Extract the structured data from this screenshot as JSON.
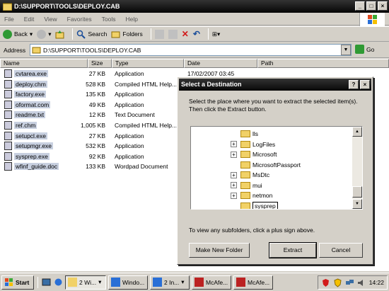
{
  "window": {
    "title": "D:\\SUPPORT\\TOOLS\\DEPLOY.CAB",
    "controls": [
      "_",
      "□",
      "×"
    ]
  },
  "menu": [
    "File",
    "Edit",
    "View",
    "Favorites",
    "Tools",
    "Help"
  ],
  "toolbar": {
    "back": "Back",
    "search": "Search",
    "folders": "Folders",
    "view": "⊞▾"
  },
  "address": {
    "label": "Address",
    "value": "D:\\SUPPORT\\TOOLS\\DEPLOY.CAB",
    "go": "Go"
  },
  "columns": [
    "Name",
    "Size",
    "Type",
    "Date",
    "Path"
  ],
  "files": [
    {
      "name": "cvtarea.exe",
      "size": "27 KB",
      "type": "Application",
      "date": "17/02/2007 03:45"
    },
    {
      "name": "deploy.chm",
      "size": "528 KB",
      "type": "Compiled HTML Help...",
      "date": ""
    },
    {
      "name": "factory.exe",
      "size": "135 KB",
      "type": "Application",
      "date": ""
    },
    {
      "name": "oformat.com",
      "size": "49 KB",
      "type": "Application",
      "date": ""
    },
    {
      "name": "readme.txt",
      "size": "12 KB",
      "type": "Text Document",
      "date": ""
    },
    {
      "name": "ref.chm",
      "size": "1,005 KB",
      "type": "Compiled HTML Help...",
      "date": ""
    },
    {
      "name": "setupcl.exe",
      "size": "27 KB",
      "type": "Application",
      "date": ""
    },
    {
      "name": "setupmgr.exe",
      "size": "532 KB",
      "type": "Application",
      "date": ""
    },
    {
      "name": "sysprep.exe",
      "size": "92 KB",
      "type": "Application",
      "date": ""
    },
    {
      "name": "wfinf_guide.doc",
      "size": "133 KB",
      "type": "Wordpad Document",
      "date": ""
    }
  ],
  "dialog": {
    "title": "Select a Destination",
    "help": "?",
    "close": "×",
    "message": "Select the place where you want to extract the selected item(s).  Then click the Extract button.",
    "tree": [
      {
        "label": "lls",
        "expandable": false
      },
      {
        "label": "LogFiles",
        "expandable": true
      },
      {
        "label": "Microsoft",
        "expandable": true
      },
      {
        "label": "MicrosoftPassport",
        "expandable": false
      },
      {
        "label": "MsDtc",
        "expandable": true
      },
      {
        "label": "mui",
        "expandable": true
      },
      {
        "label": "netmon",
        "expandable": true
      },
      {
        "label": "sysprep",
        "expandable": false,
        "editing": true
      }
    ],
    "hint": "To view any subfolders, click a plus sign above.",
    "buttons": {
      "new_folder": "Make New Folder",
      "extract": "Extract",
      "cancel": "Cancel"
    }
  },
  "taskbar": {
    "start": "Start",
    "tasks": [
      {
        "label": "2 Wi...",
        "active": true
      },
      {
        "label": "Windo...",
        "active": false
      },
      {
        "label": "2 In...",
        "active": false
      },
      {
        "label": "McAfe...",
        "active": false
      },
      {
        "label": "McAfe...",
        "active": false
      }
    ],
    "clock": "14:22"
  }
}
